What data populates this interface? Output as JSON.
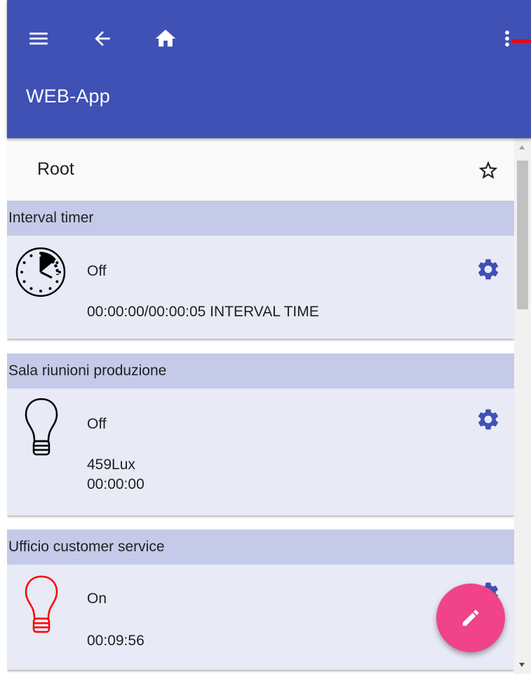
{
  "appbar": {
    "title": "WEB-App",
    "icons": [
      "menu-icon",
      "back-arrow-icon",
      "home-icon",
      "more-vert-icon"
    ],
    "color": "#3f51b5"
  },
  "root": {
    "label": "Root",
    "favorite_icon": "star-outline-icon"
  },
  "cards": [
    {
      "title": "Interval timer",
      "icon": "clock-icon",
      "status": "Off",
      "lines": [
        "00:00:00/00:00:05 INTERVAL TIME"
      ]
    },
    {
      "title": "Sala riunioni produzione",
      "icon": "lightbulb-icon",
      "status": "Off",
      "lines": [
        "459Lux",
        "00:00:00"
      ]
    },
    {
      "title": "Ufficio customer service",
      "icon": "lightbulb-icon",
      "icon_color": "#ff0000",
      "status": "On",
      "lines": [
        "00:09:56"
      ]
    }
  ],
  "fab": {
    "icon": "pencil-icon",
    "color": "#f0438a"
  },
  "colors": {
    "card_header": "#c5cae9",
    "card_body": "#e8eaf6",
    "accent": "#3f51b5"
  }
}
